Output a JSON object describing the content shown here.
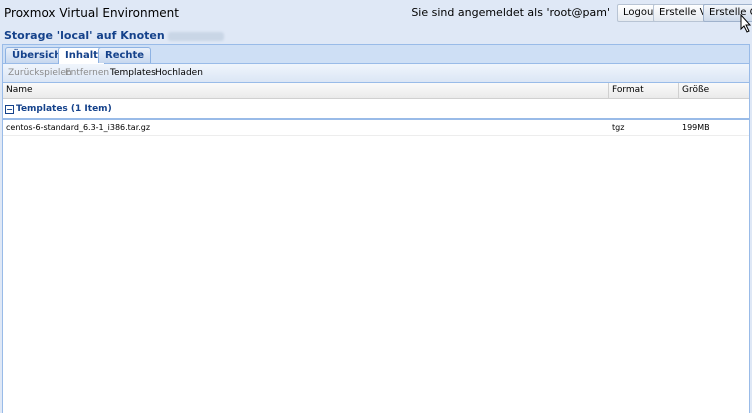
{
  "header": {
    "app_title": "Proxmox Virtual Environment",
    "login_info": "Sie sind angemeldet als 'root@pam'",
    "logout_label": "Logout",
    "create_vm_label": "Erstelle VM",
    "create_ct_label": "Erstelle CT"
  },
  "storage": {
    "title": "Storage 'local' auf Knoten"
  },
  "tabs": [
    {
      "label": "Übersicht"
    },
    {
      "label": "Inhalt"
    },
    {
      "label": "Rechte"
    }
  ],
  "toolbar": {
    "restore_label": "Zurückspielen",
    "remove_label": "Entfernen",
    "templates_label": "Templates",
    "upload_label": "Hochladen"
  },
  "grid": {
    "columns": [
      "Name",
      "Format",
      "Größe"
    ],
    "group": {
      "toggle": "−",
      "label": "Templates (1 Item)"
    },
    "rows": [
      {
        "name": "centos-6-standard_6.3-1_i386.tar.gz",
        "format": "tgz",
        "size": "199MB"
      }
    ]
  },
  "colors": {
    "accent": "#15428b",
    "panel_border": "#99bbe8",
    "background": "#dfe8f6"
  },
  "icons": [
    "mouse-cursor-icon",
    "collapse-icon"
  ]
}
